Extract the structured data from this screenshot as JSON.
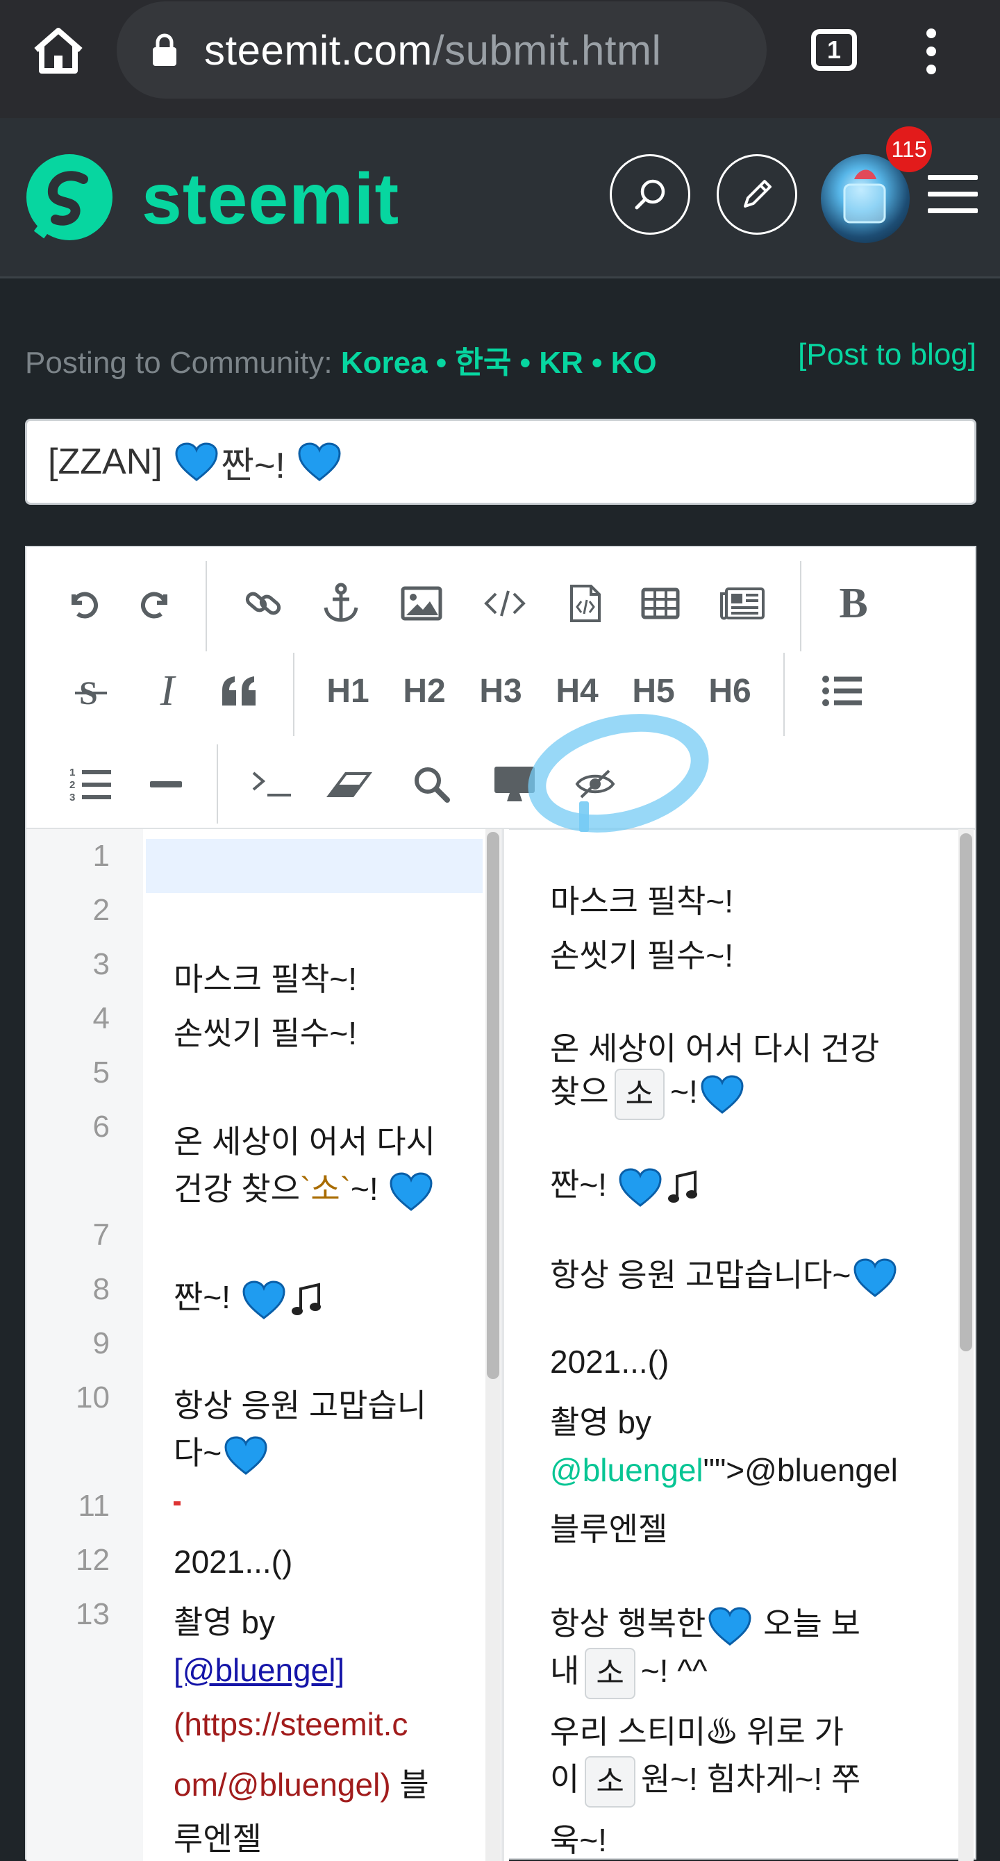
{
  "browser": {
    "url_domain": "steemit.com",
    "url_path": "/submit.html",
    "tab_count": "1",
    "icons": [
      "home-icon",
      "lock-icon",
      "tabs-icon",
      "menu-dots-icon"
    ]
  },
  "header": {
    "logo_text": "steemit",
    "notifications_count": "115",
    "icons": [
      "steemit-logo-icon",
      "search-icon",
      "pencil-icon",
      "avatar",
      "hamburger-icon"
    ],
    "accent_color": "#07d6a0"
  },
  "posting": {
    "label": "Posting to Community: ",
    "community": "Korea • 한국 • KR • KO",
    "post_to_blog": "[Post to blog]"
  },
  "title_input": {
    "value_prefix": "[ZZAN] ",
    "value_text": "짠~! "
  },
  "toolbar": {
    "headings": [
      "H1",
      "H2",
      "H3",
      "H4",
      "H5",
      "H6"
    ],
    "bold": "B",
    "icons": [
      "undo-icon",
      "redo-icon",
      "link-icon",
      "anchor-icon",
      "image-icon",
      "code-icon",
      "code-file-icon",
      "table-icon",
      "newspaper-icon",
      "bold-icon",
      "strikethrough-icon",
      "italic-icon",
      "quote-icon",
      "unordered-list-icon",
      "ordered-list-icon",
      "horizontal-rule-icon",
      "terminal-icon",
      "eraser-icon",
      "search-icon",
      "desktop-icon",
      "hide-preview-icon"
    ]
  },
  "editor": {
    "line_numbers": [
      "1",
      "2",
      "3",
      "4",
      "5",
      "6",
      "7",
      "8",
      "9",
      "10",
      "11",
      "12",
      "13"
    ],
    "lines": {
      "l3": "마스크 필착~!",
      "l4": "손씻기 필수~!",
      "l6a": "온 세상이 어서 다시",
      "l6b_pre": "건강 찾으",
      "l6b_code": "`소`",
      "l6b_post": "~! ",
      "l8": "짠~! ",
      "l10a": "항상 응원 고맙습니",
      "l10b": "다~",
      "l12": "2021...()",
      "l13a": "촬영 by",
      "l13b": "[@bluengel]",
      "l13c": "(https://steemit.c",
      "l13d": "om/@bluengel)",
      "l13d_post": " 블",
      "l13e": "루엔젤"
    }
  },
  "preview": {
    "p1": "마스크 필착~!",
    "p2": "손씻기 필수~!",
    "p3": "온 세상이 어서 다시 건강",
    "p4_pre": "찾으",
    "p4_kbd": "소",
    "p4_post": "~!",
    "p5": "짠~! ",
    "p6": "항상 응원 고맙습니다~",
    "p7": "2021...()",
    "p8": "촬영 by",
    "p9_link": "@bluengel",
    "p9_rest": "\"\">@bluengel",
    "p10": "블루엔젤",
    "p11_pre": "항상 행복한",
    "p11_post": " 오늘 보",
    "p12_pre": "내",
    "p12_kbd": "소",
    "p12_post": "~! ^^",
    "p13": "우리 스티미♨ 위로 가",
    "p14_pre": "이",
    "p14_kbd": "소",
    "p14_post": "원~! 힘차게~! 쭈",
    "p15": "욱~!"
  }
}
